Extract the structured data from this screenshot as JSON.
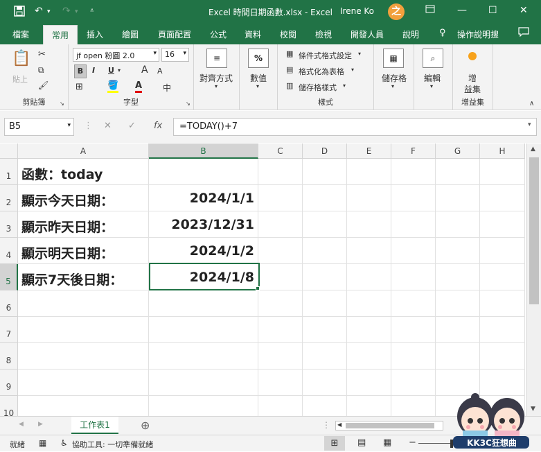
{
  "title_bar": {
    "save_icon": "save-icon",
    "undo_icon": "undo-icon",
    "redo_icon": "redo-icon",
    "customize_icon": "customize-qat-icon",
    "title": "Excel 時間日期函數.xlsx - Excel",
    "user": "Irene Ko",
    "avatar_letter": "之",
    "share_icon": "ribbon-display-icon",
    "minimize": "—",
    "maximize": "☐",
    "close": "✕"
  },
  "tabs": [
    "檔案",
    "常用",
    "插入",
    "繪圖",
    "頁面配置",
    "公式",
    "資料",
    "校閱",
    "檢視",
    "開發人員",
    "說明"
  ],
  "tell_me": "操作說明搜",
  "ribbon": {
    "clipboard": {
      "paste": "貼上",
      "label": "剪貼簿"
    },
    "font": {
      "name": "jf open 粉圓 2.0",
      "size": "16",
      "bold": "B",
      "italic": "I",
      "underline": "U",
      "grow": "A",
      "shrink": "A",
      "phonetic": "中",
      "label": "字型"
    },
    "alignment": {
      "label": "對齊方式"
    },
    "number": {
      "label": "數值",
      "icon_text": "%"
    },
    "styles": {
      "cond": "條件式格式設定",
      "table": "格式化為表格",
      "cell": "儲存格樣式",
      "label": "樣式"
    },
    "cells": {
      "label": "儲存格"
    },
    "editing": {
      "label": "編輯"
    },
    "addins": {
      "label1": "增",
      "label2": "益集",
      "group_label": "增益集"
    }
  },
  "formula_bar": {
    "name_box": "B5",
    "cancel": "✕",
    "enter": "✓",
    "fx": "fx",
    "formula": "=TODAY()+7"
  },
  "columns": [
    "A",
    "B",
    "C",
    "D",
    "E",
    "F",
    "G",
    "H"
  ],
  "rows": [
    {
      "num": "1",
      "a": "函數：today",
      "b": ""
    },
    {
      "num": "2",
      "a": "顯示今天日期：",
      "b": "2024/1/1"
    },
    {
      "num": "3",
      "a": "顯示昨天日期：",
      "b": "2023/12/31"
    },
    {
      "num": "4",
      "a": "顯示明天日期：",
      "b": "2024/1/2"
    },
    {
      "num": "5",
      "a": "顯示7天後日期：",
      "b": "2024/1/8"
    },
    {
      "num": "6",
      "a": "",
      "b": ""
    },
    {
      "num": "7",
      "a": "",
      "b": ""
    },
    {
      "num": "8",
      "a": "",
      "b": ""
    },
    {
      "num": "9",
      "a": "",
      "b": ""
    },
    {
      "num": "10",
      "a": "",
      "b": ""
    }
  ],
  "sheet": {
    "tab": "工作表1",
    "add": "⊕"
  },
  "status": {
    "ready": "就緒",
    "accessibility": "協助工具: 一切準備就緒"
  },
  "watermark": "KK3C狂想曲"
}
